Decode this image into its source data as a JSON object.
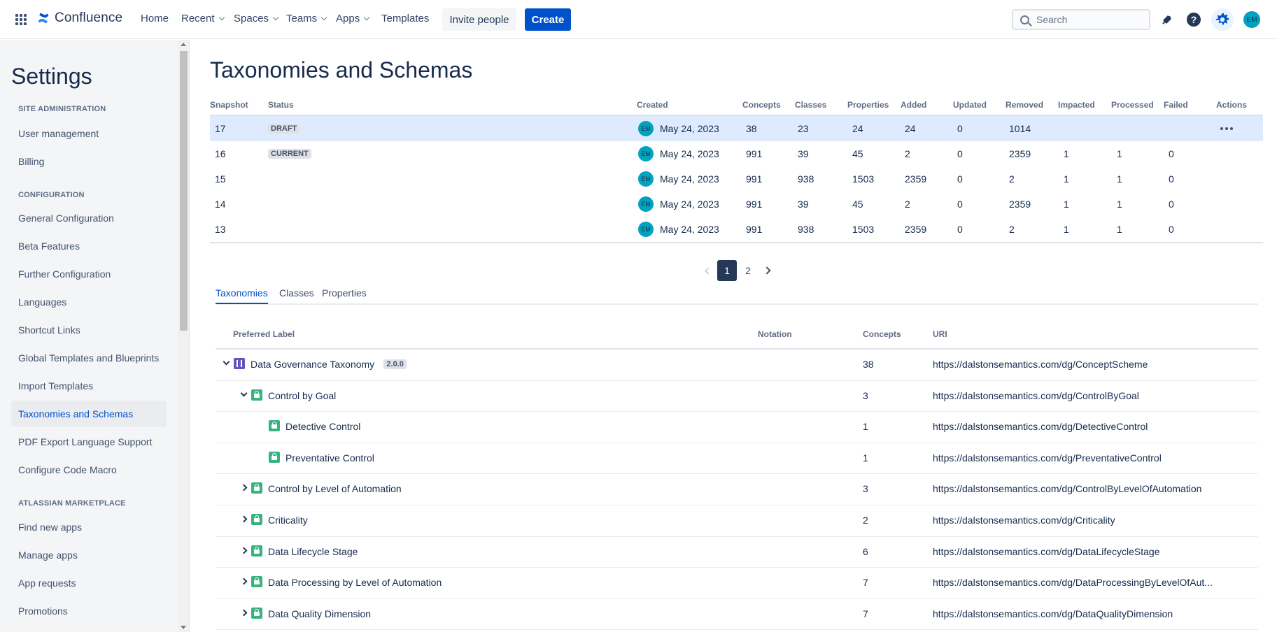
{
  "topnav": {
    "logo_text": "Confluence",
    "items": [
      {
        "label": "Home",
        "dropdown": false
      },
      {
        "label": "Recent",
        "dropdown": true
      },
      {
        "label": "Spaces",
        "dropdown": true
      },
      {
        "label": "Teams",
        "dropdown": true
      },
      {
        "label": "Apps",
        "dropdown": true
      },
      {
        "label": "Templates",
        "dropdown": false
      }
    ],
    "invite_label": "Invite people",
    "create_label": "Create",
    "search_placeholder": "Search",
    "avatar_initials": "EM",
    "colors": {
      "brand": "#0052cc",
      "avatar": "#00a3bf"
    }
  },
  "sidebar": {
    "title": "Settings",
    "sections": [
      {
        "heading": "SITE ADMINISTRATION",
        "items": [
          "User management",
          "Billing"
        ]
      },
      {
        "heading": "CONFIGURATION",
        "items": [
          "General Configuration",
          "Beta Features",
          "Further Configuration",
          "Languages",
          "Shortcut Links",
          "Global Templates and Blueprints",
          "Import Templates",
          "Taxonomies and Schemas",
          "PDF Export Language Support",
          "Configure Code Macro"
        ]
      },
      {
        "heading": "ATLASSIAN MARKETPLACE",
        "items": [
          "Find new apps",
          "Manage apps",
          "App requests",
          "Promotions"
        ]
      }
    ],
    "active_item": "Taxonomies and Schemas"
  },
  "main": {
    "title": "Taxonomies and Schemas",
    "snapshot_columns": [
      "Snapshot",
      "Status",
      "Created",
      "Concepts",
      "Classes",
      "Properties",
      "Added",
      "Updated",
      "Removed",
      "Impacted",
      "Processed",
      "Failed",
      "Actions"
    ],
    "snapshots": [
      {
        "snapshot": "17",
        "status": "DRAFT",
        "avatar": "EM",
        "created": "May 24, 2023",
        "concepts": "38",
        "classes": "23",
        "properties": "24",
        "added": "24",
        "updated": "0",
        "removed": "1014",
        "impacted": "",
        "processed": "",
        "failed": "",
        "selected": true
      },
      {
        "snapshot": "16",
        "status": "CURRENT",
        "avatar": "EM",
        "created": "May 24, 2023",
        "concepts": "991",
        "classes": "39",
        "properties": "45",
        "added": "2",
        "updated": "0",
        "removed": "2359",
        "impacted": "1",
        "processed": "1",
        "failed": "0",
        "selected": false
      },
      {
        "snapshot": "15",
        "status": "",
        "avatar": "EM",
        "created": "May 24, 2023",
        "concepts": "991",
        "classes": "938",
        "properties": "1503",
        "added": "2359",
        "updated": "0",
        "removed": "2",
        "impacted": "1",
        "processed": "1",
        "failed": "0",
        "selected": false
      },
      {
        "snapshot": "14",
        "status": "",
        "avatar": "EM",
        "created": "May 24, 2023",
        "concepts": "991",
        "classes": "39",
        "properties": "45",
        "added": "2",
        "updated": "0",
        "removed": "2359",
        "impacted": "1",
        "processed": "1",
        "failed": "0",
        "selected": false
      },
      {
        "snapshot": "13",
        "status": "",
        "avatar": "EM",
        "created": "May 24, 2023",
        "concepts": "991",
        "classes": "938",
        "properties": "1503",
        "added": "2359",
        "updated": "0",
        "removed": "2",
        "impacted": "1",
        "processed": "1",
        "failed": "0",
        "selected": false
      }
    ],
    "pagination": {
      "pages": [
        "1",
        "2"
      ],
      "current": "1"
    },
    "tabs": [
      "Taxonomies",
      "Classes",
      "Properties"
    ],
    "active_tab": "Taxonomies",
    "taxonomy_columns": [
      "Preferred Label",
      "Notation",
      "Concepts",
      "URI"
    ],
    "taxonomy_rows": [
      {
        "label": "Data Governance Taxonomy",
        "version": "2.0.0",
        "level": 0,
        "expand": "down",
        "icon": "scheme-icon",
        "notation": "",
        "concepts": "38",
        "uri": "https://dalstonsemantics.com/dg/ConceptScheme"
      },
      {
        "label": "Control by Goal",
        "version": "",
        "level": 1,
        "expand": "down",
        "icon": "concept-icon",
        "notation": "",
        "concepts": "3",
        "uri": "https://dalstonsemantics.com/dg/ControlByGoal"
      },
      {
        "label": "Detective Control",
        "version": "",
        "level": 2,
        "expand": "none",
        "icon": "concept-icon",
        "notation": "",
        "concepts": "1",
        "uri": "https://dalstonsemantics.com/dg/DetectiveControl"
      },
      {
        "label": "Preventative Control",
        "version": "",
        "level": 2,
        "expand": "none",
        "icon": "concept-icon",
        "notation": "",
        "concepts": "1",
        "uri": "https://dalstonsemantics.com/dg/PreventativeControl"
      },
      {
        "label": "Control by Level of Automation",
        "version": "",
        "level": 1,
        "expand": "right",
        "icon": "concept-icon",
        "notation": "",
        "concepts": "3",
        "uri": "https://dalstonsemantics.com/dg/ControlByLevelOfAutomation"
      },
      {
        "label": "Criticality",
        "version": "",
        "level": 1,
        "expand": "right",
        "icon": "concept-icon",
        "notation": "",
        "concepts": "2",
        "uri": "https://dalstonsemantics.com/dg/Criticality"
      },
      {
        "label": "Data Lifecycle Stage",
        "version": "",
        "level": 1,
        "expand": "right",
        "icon": "concept-icon",
        "notation": "",
        "concepts": "6",
        "uri": "https://dalstonsemantics.com/dg/DataLifecycleStage"
      },
      {
        "label": "Data Processing by Level of Automation",
        "version": "",
        "level": 1,
        "expand": "right",
        "icon": "concept-icon",
        "notation": "",
        "concepts": "7",
        "uri": "https://dalstonsemantics.com/dg/DataProcessingByLevelOfAut..."
      },
      {
        "label": "Data Quality Dimension",
        "version": "",
        "level": 1,
        "expand": "right",
        "icon": "concept-icon",
        "notation": "",
        "concepts": "7",
        "uri": "https://dalstonsemantics.com/dg/DataQualityDimension"
      }
    ]
  }
}
